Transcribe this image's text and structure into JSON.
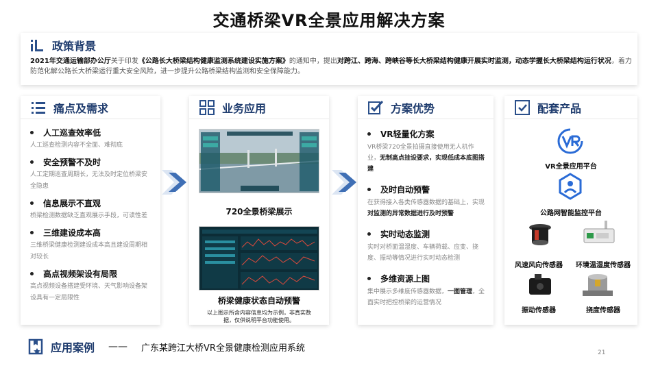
{
  "title": "交通桥梁VR全景应用解决方案",
  "policy": {
    "title": "政策背景",
    "text": {
      "year_lead": "2021年交通运输部办公厅",
      "p1": "关于印发",
      "doc": "《公路长大桥梁结构健康监测系统建设实施方案》",
      "p2": "的通知中，提出",
      "k1": "对跨江、跨海、跨峡谷等长大桥梁结构健康开展实时监测，动态学握长大桥梁结构运行状况",
      "p3": "，着力防范化解公路长大桥梁运行重大安全风险，进一步提升公路桥梁结构监测和安全保障能力。"
    }
  },
  "pain": {
    "title": "痛点及需求",
    "items": [
      {
        "title": "人工巡查效率低",
        "desc": "人工巡查检测内容不全面、难彻底"
      },
      {
        "title": "安全预警不及时",
        "desc": "人工定期巡查周期长，无法及时定位桥梁安全隐患"
      },
      {
        "title": "信息展示不直观",
        "desc": "桥梁检测数据缺乏直观展示手段，可读性差"
      },
      {
        "title": "三维建设成本高",
        "desc": "三维桥梁健康检测建设成本高且建设周期相对较长"
      },
      {
        "title": "高点视频架设有局限",
        "desc": "高点视频设备搭建受环境、天气影响设备架设具有一定局限性"
      }
    ]
  },
  "apps": {
    "title": "业务应用",
    "cap1": "720全景桥梁展示",
    "cap2": "桥梁健康状态自动预警",
    "note": "以上图示所含内容信息均为示例，非真实数据，仅供说明平台功能使用。"
  },
  "adv": {
    "title": "方案优势",
    "items": [
      {
        "title": "VR轻量化方案",
        "d1": "VR桥梁720全景拍摄直接使用无人机作业，",
        "b1": "无制高点挂设要求，实现低成本底图搭建",
        "d2": ""
      },
      {
        "title": "及时自动预警",
        "d1": "在获得接入各类传感器数据的基础上，实现",
        "b1": "对监测的异常数据进行及时预警",
        "d2": ""
      },
      {
        "title": "实时动态监测",
        "d1": "实时对桥面温湿度、车辆荷载、应变、挠度、振动等情况进行实时动态检测",
        "b1": "",
        "d2": ""
      },
      {
        "title": "多维资源上图",
        "d1": "集中展示多维度传感器数据，",
        "b1": "一图管理",
        "d2": "，全面实时把控桥梁的运营情况"
      }
    ]
  },
  "products": {
    "title": "配套产品",
    "p1": "VR全景应用平台",
    "p2": "公路网智能监控平台",
    "p3": "风速风向传感器",
    "p4": "环境温湿度传感器",
    "p5": "振动传感器",
    "p6": "挠度传感器"
  },
  "case": {
    "title": "应用案例",
    "dash": "——",
    "text": "广东某跨江大桥VR全景健康检测应用系统"
  },
  "page_number": "21",
  "colors": {
    "accent": "#2a6bd6",
    "title_blue": "#1f3c6e",
    "arrow": "#3f6fb5"
  }
}
